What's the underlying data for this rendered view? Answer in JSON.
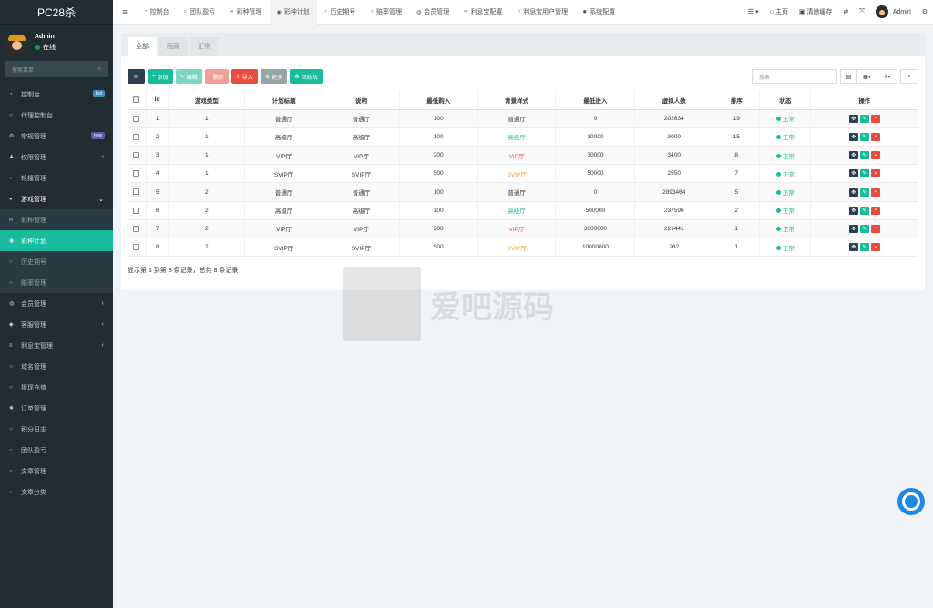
{
  "app": {
    "title": "PC28杀"
  },
  "user": {
    "name": "Admin",
    "status": "在线"
  },
  "sidebar": {
    "search_placeholder": "搜索菜单",
    "items": [
      {
        "label": "控制台",
        "icon": "dashboard-icon",
        "badge": "hot",
        "badge_color": "#3c8dbc"
      },
      {
        "label": "代理控制台",
        "icon": "circle-icon"
      },
      {
        "label": "常规管理",
        "icon": "cogs-icon",
        "badge": "new",
        "badge_color": "#605ca8"
      },
      {
        "label": "权限管理",
        "icon": "group-icon",
        "arrow": "‹"
      },
      {
        "label": "轮播管理",
        "icon": "circle-icon"
      },
      {
        "label": "游戏管理",
        "icon": "game-icon",
        "arrow": "⌄",
        "state": "open"
      },
      {
        "label": "彩种管理",
        "icon": "link-icon",
        "state": "sub"
      },
      {
        "label": "彩种计划",
        "icon": "life-ring-icon",
        "state": "active"
      },
      {
        "label": "历史期号",
        "icon": "circle-icon",
        "state": "sub"
      },
      {
        "label": "赔率管理",
        "icon": "circle-icon",
        "state": "sub"
      },
      {
        "label": "会员管理",
        "icon": "user-circle-icon",
        "arrow": "‹"
      },
      {
        "label": "客服管理",
        "icon": "comment-icon",
        "arrow": "‹"
      },
      {
        "label": "利息宝管理",
        "icon": "list-icon",
        "arrow": "‹"
      },
      {
        "label": "域名管理",
        "icon": "circle-icon"
      },
      {
        "label": "提现充值",
        "icon": "circle-icon"
      },
      {
        "label": "订单管理",
        "icon": "gear-icon"
      },
      {
        "label": "积分日志",
        "icon": "circle-icon"
      },
      {
        "label": "团队盈亏",
        "icon": "circle-icon"
      },
      {
        "label": "文章管理",
        "icon": "circle-icon"
      },
      {
        "label": "文章分类",
        "icon": "circle-icon"
      }
    ]
  },
  "topbar": {
    "tabs": [
      {
        "label": "控制台",
        "icon": "dashboard-icon"
      },
      {
        "label": "团队盈亏",
        "icon": "circle-icon"
      },
      {
        "label": "彩种管理",
        "icon": "link-icon"
      },
      {
        "label": "彩种计划",
        "icon": "life-ring-icon",
        "active": true
      },
      {
        "label": "历史期号",
        "icon": "circle-icon"
      },
      {
        "label": "赔率管理",
        "icon": "circle-icon"
      },
      {
        "label": "会员管理",
        "icon": "user-circle-icon"
      },
      {
        "label": "利息宝配置",
        "icon": "link-icon"
      },
      {
        "label": "利息宝用户管理",
        "icon": "circle-icon"
      },
      {
        "label": "系统配置",
        "icon": "gear-icon"
      }
    ],
    "right": {
      "home": "主页",
      "clear_cache": "清除缓存",
      "admin": "Admin"
    }
  },
  "subtabs": [
    "全部",
    "隐藏",
    "正常"
  ],
  "toolbar": {
    "add": "添加",
    "edit": "编辑",
    "delete": "删除",
    "import": "导入",
    "more": "更多",
    "recycle": "回收站"
  },
  "search": {
    "placeholder": "搜索"
  },
  "table": {
    "headers": [
      "Id",
      "游戏类型",
      "计划标题",
      "说明",
      "最低购入",
      "背景样式",
      "最低进入",
      "虚拟人数",
      "排序",
      "状态",
      "操作"
    ],
    "rows": [
      {
        "id": "1",
        "type": "1",
        "title": "普通厅",
        "desc": "普通厅",
        "min_buy": "100",
        "bg": "普通厅",
        "bg_color": "#333333",
        "min_enter": "0",
        "virtual": "202634",
        "sort": "19",
        "status": "正常"
      },
      {
        "id": "2",
        "type": "1",
        "title": "高级厅",
        "desc": "高级厅",
        "min_buy": "100",
        "bg": "高级厅",
        "bg_color": "#18bc9c",
        "min_enter": "10000",
        "virtual": "3000",
        "sort": "15",
        "status": "正常"
      },
      {
        "id": "3",
        "type": "1",
        "title": "VIP厅",
        "desc": "VIP厅",
        "min_buy": "200",
        "bg": "VIP厅",
        "bg_color": "#e74c3c",
        "min_enter": "30000",
        "virtual": "3400",
        "sort": "8",
        "status": "正常"
      },
      {
        "id": "4",
        "type": "1",
        "title": "SVIP厅",
        "desc": "SVIP厅",
        "min_buy": "500",
        "bg": "SVIP厅",
        "bg_color": "#f39c12",
        "min_enter": "50000",
        "virtual": "2550",
        "sort": "7",
        "status": "正常"
      },
      {
        "id": "5",
        "type": "2",
        "title": "普通厅",
        "desc": "普通厅",
        "min_buy": "100",
        "bg": "普通厅",
        "bg_color": "#333333",
        "min_enter": "0",
        "virtual": "2893464",
        "sort": "5",
        "status": "正常"
      },
      {
        "id": "6",
        "type": "2",
        "title": "高级厅",
        "desc": "高级厅",
        "min_buy": "100",
        "bg": "高级厅",
        "bg_color": "#18bc9c",
        "min_enter": "500000",
        "virtual": "237596",
        "sort": "2",
        "status": "正常"
      },
      {
        "id": "7",
        "type": "2",
        "title": "VIP厅",
        "desc": "VIP厅",
        "min_buy": "200",
        "bg": "VIP厅",
        "bg_color": "#e74c3c",
        "min_enter": "3000000",
        "virtual": "221441",
        "sort": "1",
        "status": "正常"
      },
      {
        "id": "8",
        "type": "2",
        "title": "SVIP厅",
        "desc": "SVIP厅",
        "min_buy": "500",
        "bg": "SVIP厅",
        "bg_color": "#f39c12",
        "min_enter": "10000000",
        "virtual": "262",
        "sort": "1",
        "status": "正常"
      }
    ]
  },
  "pager": {
    "summary": "显示第 1 到第 8 条记录，总共 8 条记录"
  },
  "watermark": {
    "text": "爱吧源码"
  }
}
